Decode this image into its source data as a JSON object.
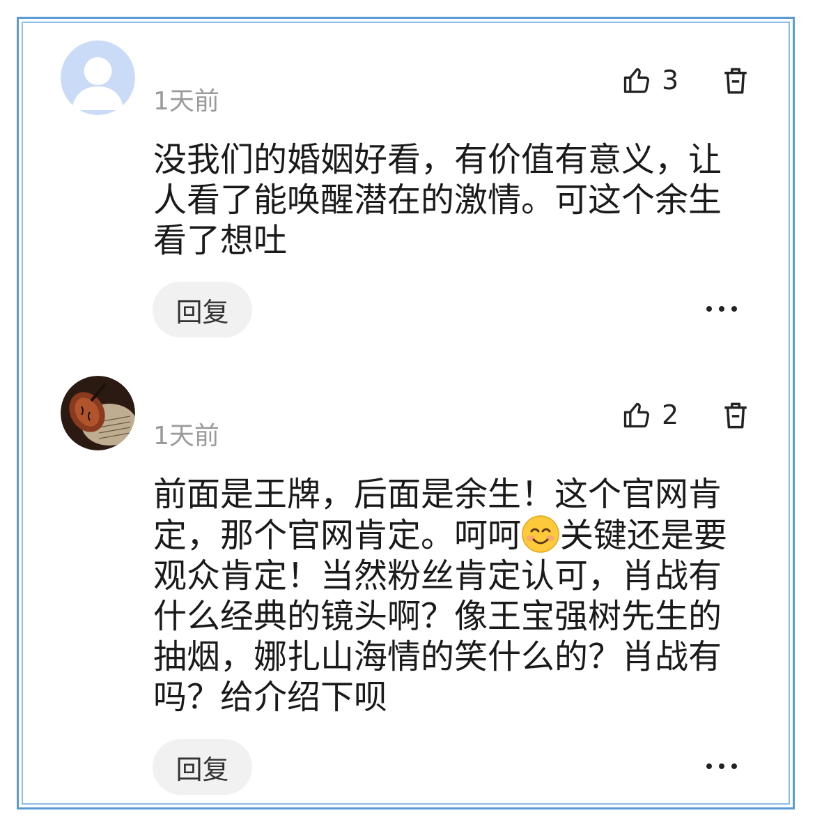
{
  "comments": [
    {
      "time": "1天前",
      "likes": "3",
      "text": "没我们的婚姻好看，有价值有意义，让人看了能唤醒潜在的激情。可这个余生看了想吐",
      "reply_label": "回复"
    },
    {
      "time": "1天前",
      "likes": "2",
      "text_before_emoji": "前面是王牌，后面是余生！这个官网肯定，那个官网肯定。呵呵",
      "text_after_emoji": "关键还是要观众肯定！当然粉丝肯定认可，肖战有什么经典的镜头啊？像王宝强树先生的抽烟，娜扎山海情的笑什么的？肖战有吗？给介绍下呗",
      "reply_label": "回复"
    }
  ],
  "icons": {
    "like": "thumbs-up-icon",
    "delete": "trash-icon",
    "more": "more-dots-icon",
    "emoji": "smiling-face-emoji"
  },
  "colors": {
    "frame": "#5b9bd5",
    "time_text": "#9a9a9a",
    "reply_bg": "#f1f1f1"
  }
}
